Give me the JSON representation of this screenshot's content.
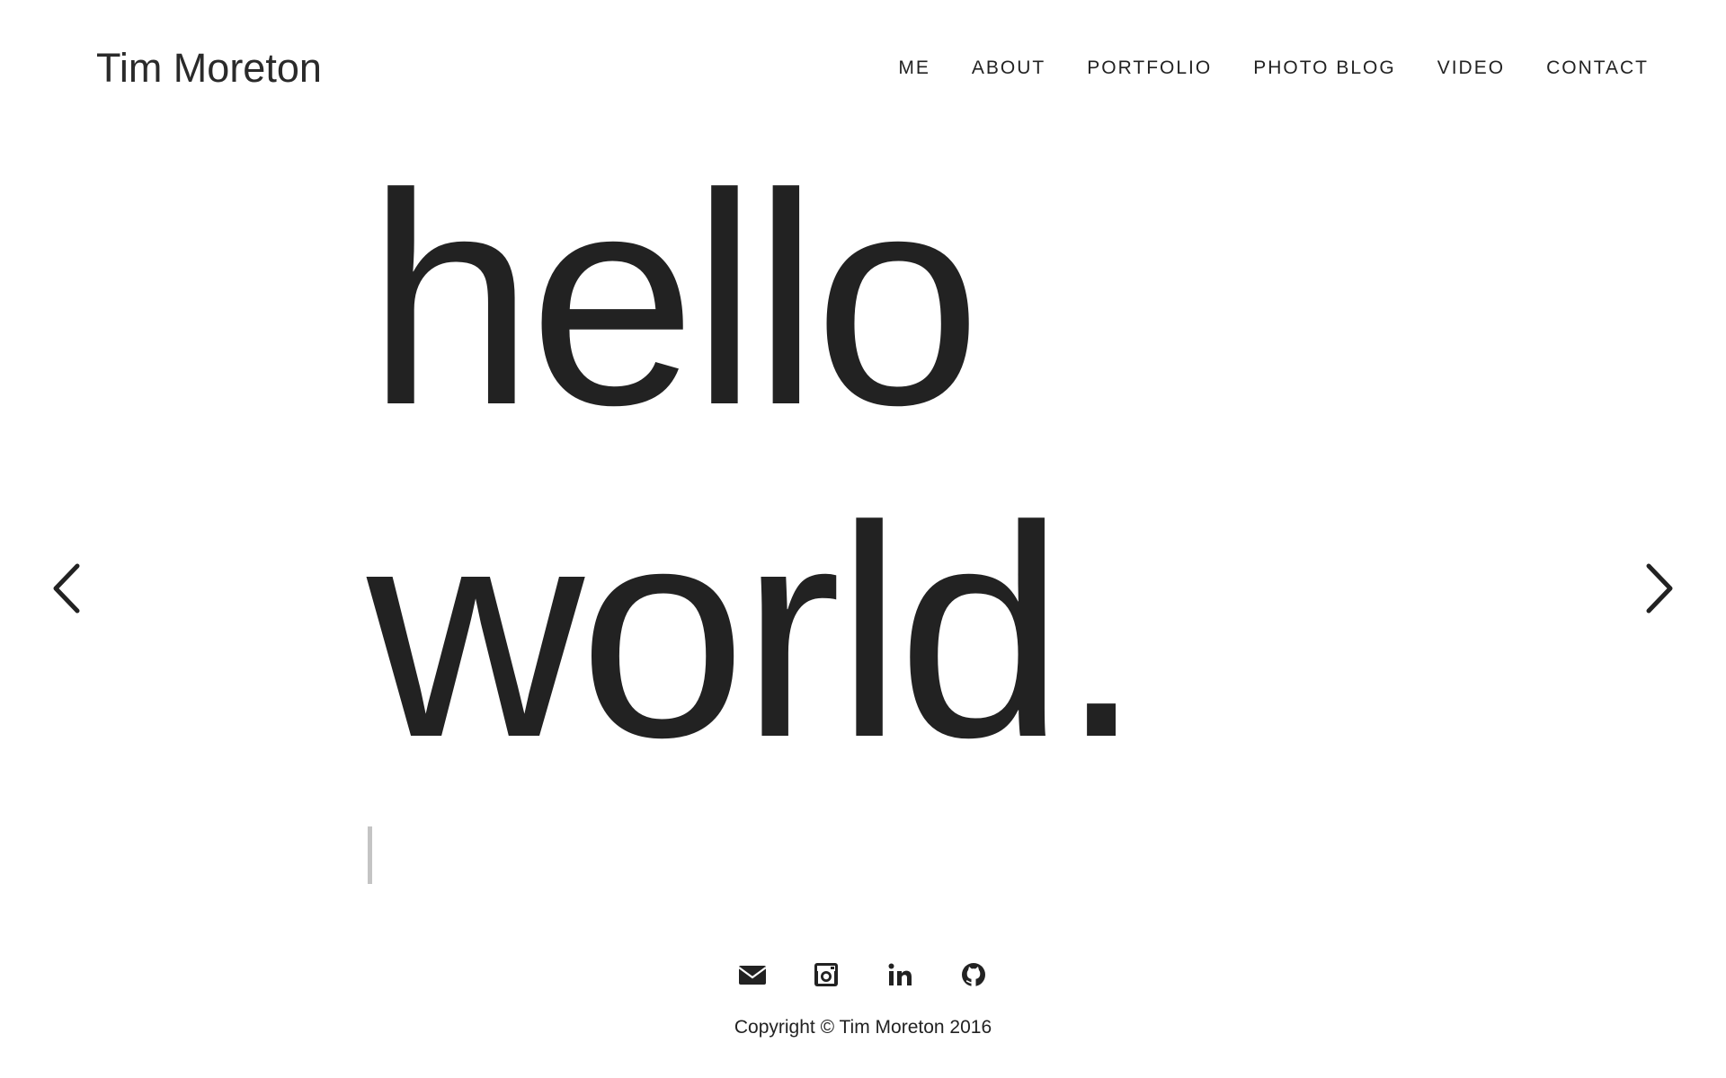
{
  "brand": {
    "name": "Tim Moreton"
  },
  "nav": {
    "items": [
      {
        "label": "ME"
      },
      {
        "label": "ABOUT"
      },
      {
        "label": "PORTFOLIO"
      },
      {
        "label": "PHOTO BLOG"
      },
      {
        "label": "VIDEO"
      },
      {
        "label": "CONTACT"
      }
    ]
  },
  "hero": {
    "line1": "hello",
    "line2": "world."
  },
  "carousel": {
    "prev_icon": "chevron-left-icon",
    "next_icon": "chevron-right-icon"
  },
  "social": {
    "icons": [
      "envelope-icon",
      "instagram-icon",
      "linkedin-icon",
      "github-icon"
    ]
  },
  "footer": {
    "copyright": "Copyright © Tim Moreton 2016"
  },
  "colors": {
    "text": "#222222",
    "background": "#ffffff",
    "cursor": "#c4c4c4"
  }
}
